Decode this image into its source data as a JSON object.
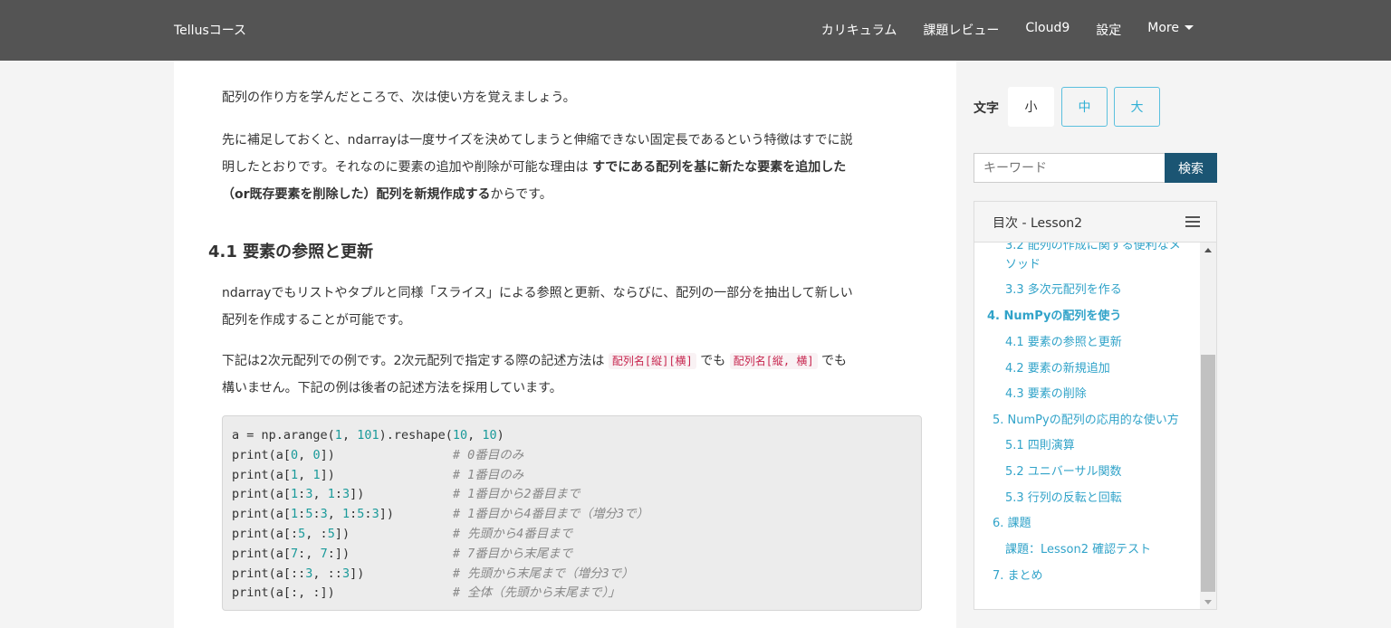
{
  "navbar": {
    "brand": "Tellusコース",
    "items": [
      "カリキュラム",
      "課題レビュー",
      "Cloud9",
      "設定"
    ],
    "more": "More"
  },
  "content": {
    "p1": "配列の作り方を学んだところで、次は使い方を覚えましょう。",
    "p2_line1": "先に補足しておくと、ndarrayは一度サイズを決めてしまうと伸縮できない固定長であるという特徴はすでに説",
    "p2_line2_pre": "明したとおりです。それなのに要素の追加や削除が可能な理由は ",
    "p2_line2_bold": "すでにある配列を基に新たな要素を追加した",
    "p2_line3_bold": "（or既存要素を削除した）配列を新規作成する",
    "p2_line3_post": "からです。",
    "heading": "4.1 要素の参照と更新",
    "p3_line1": "ndarrayでもリストやタプルと同様「スライス」による参照と更新、ならびに、配列の一部分を抽出して新しい",
    "p3_line2": "配列を作成することが可能です。",
    "p4_pre": "下記は2次元配列での例です。2次元配列で指定する際の記述方法は ",
    "p4_code1": "配列名[縦][横]",
    "p4_mid": " でも ",
    "p4_code2": "配列名[縦, 横]",
    "p4_post": " でも",
    "p4_line2": "構いません。下記の例は後者の記述方法を採用しています。"
  },
  "code_lines": [
    {
      "code": "a = np.arange(1, 101).reshape(10, 10)",
      "comment": ""
    },
    {
      "code": "print(a[0, 0])",
      "comment": "# 0番目のみ"
    },
    {
      "code": "print(a[1, 1])",
      "comment": "# 1番目のみ"
    },
    {
      "code": "print(a[1:3, 1:3])",
      "comment": "# 1番目から2番目まで"
    },
    {
      "code": "print(a[1:5:3, 1:5:3])",
      "comment": "# 1番目から4番目まで（増分3で）"
    },
    {
      "code": "print(a[:5, :5])",
      "comment": "# 先頭から4番目まで"
    },
    {
      "code": "print(a[7:, 7:])",
      "comment": "# 7番目から末尾まで"
    },
    {
      "code": "print(a[::3, ::3])",
      "comment": "# 先頭から末尾まで（増分3で）"
    },
    {
      "code": "print(a[:, :])",
      "comment": "# 全体（先頭から末尾まで）」"
    }
  ],
  "sidebar": {
    "font_label": "文字",
    "font_small": "小",
    "font_medium": "中",
    "font_large": "大",
    "search_placeholder": "キーワード",
    "search_button": "検索",
    "toc_title": "目次 - Lesson2",
    "toc_items": [
      "3.2 配列の作成に関する便利なメ",
      "ソッド",
      "3.3 多次元配列を作る",
      "4. NumPyの配列を使う",
      "4.1 要素の参照と更新",
      "4.2 要素の新規追加",
      "4.3 要素の削除",
      "5. NumPyの配列の応用的な使い方",
      "5.1 四則演算",
      "5.2 ユニバーサル関数",
      "5.3 行列の反転と回転",
      "6. 課題",
      "課題：Lesson2 確認テスト",
      "7. まとめ"
    ]
  },
  "colors": {
    "navbar": "#545454",
    "link": "#31a3c9",
    "search_button": "#1b5573",
    "font_button_border": "#5bc0de"
  }
}
